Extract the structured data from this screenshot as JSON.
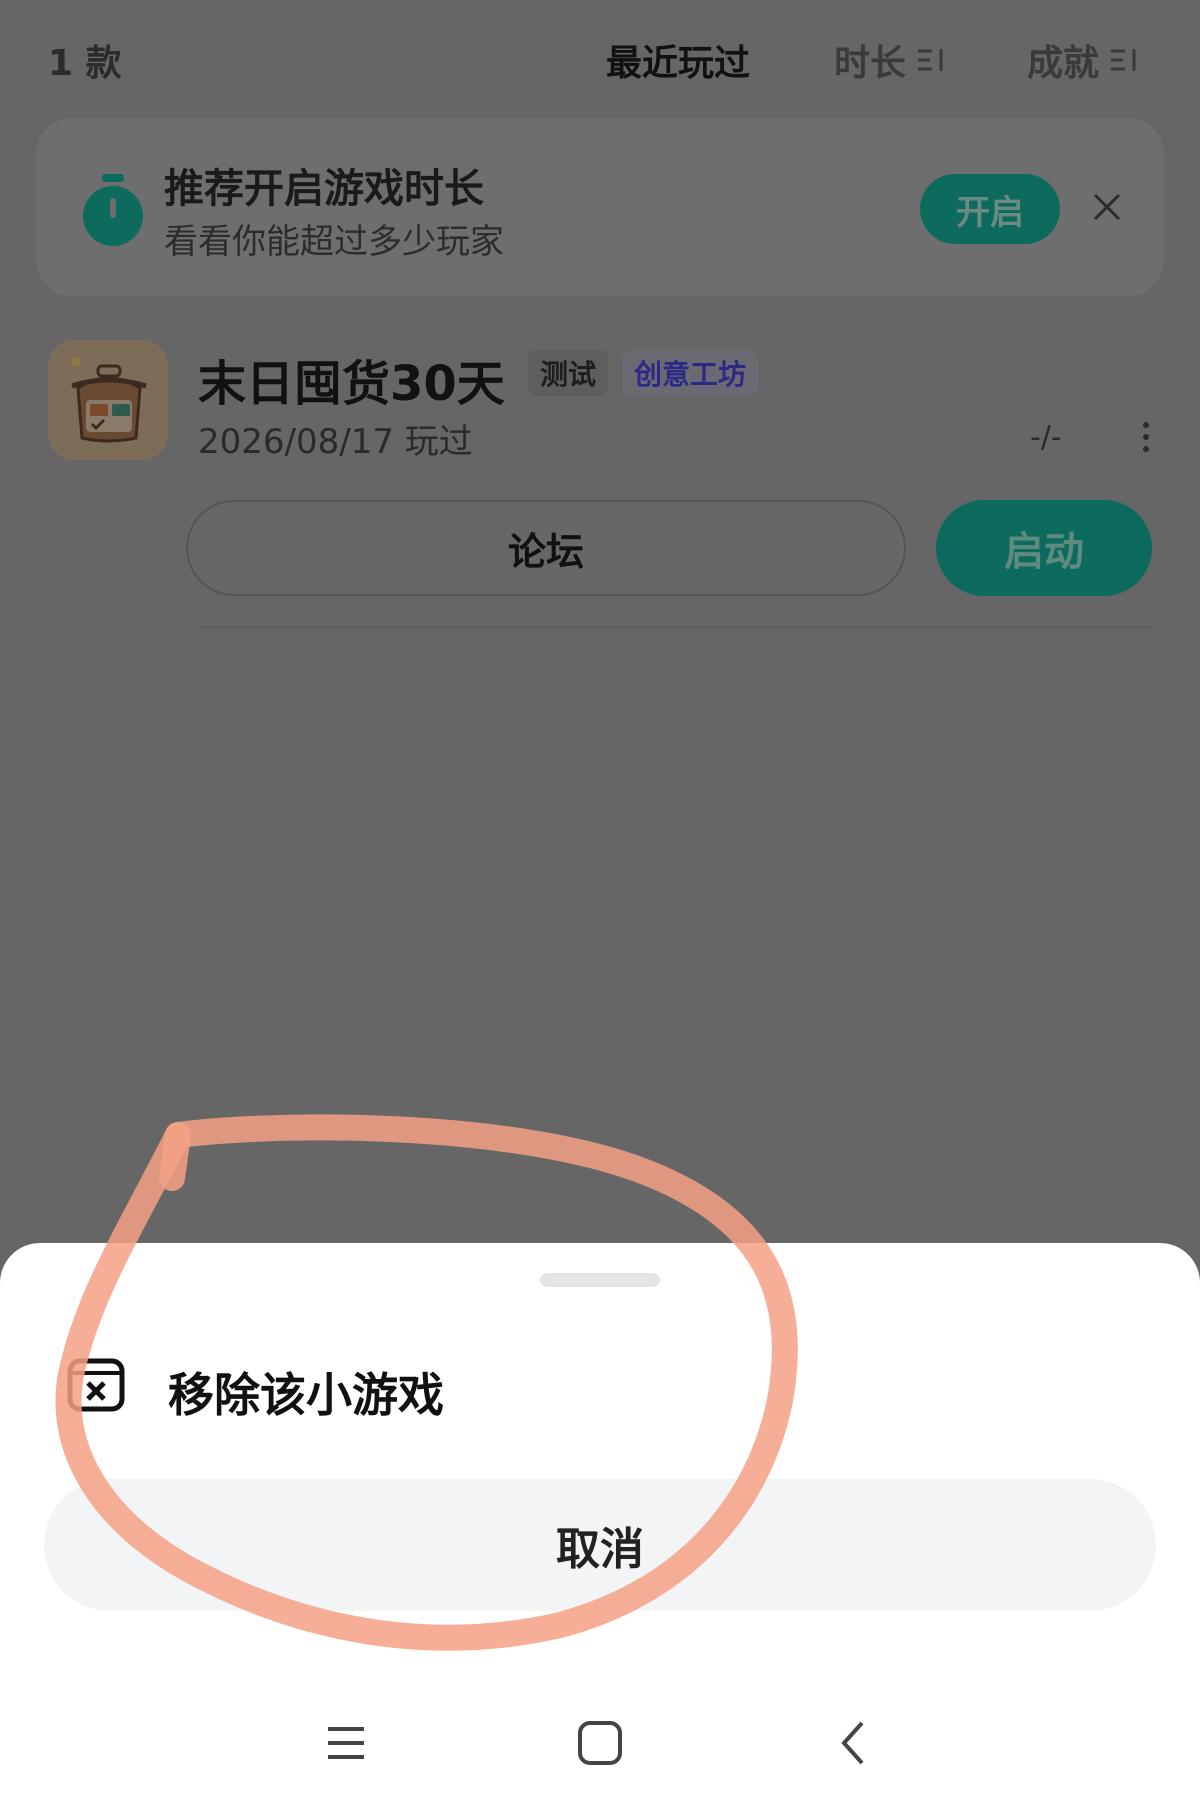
{
  "header": {
    "count_label": "1 款",
    "sort_options": [
      {
        "label": "最近玩过",
        "active": true
      },
      {
        "label": "时长",
        "active": false
      },
      {
        "label": "成就",
        "active": false
      }
    ]
  },
  "tip_card": {
    "title": "推荐开启游戏时长",
    "subtitle": "看看你能超过多少玩家",
    "enable_label": "开启",
    "icon": "stopwatch-icon"
  },
  "game": {
    "title": "末日囤货30天",
    "tags": [
      "测试",
      "创意工坊"
    ],
    "played_date": "2026/08/17 玩过",
    "stat": "-/-",
    "forum_label": "论坛",
    "launch_label": "启动"
  },
  "sheet": {
    "remove_label": "移除该小游戏",
    "cancel_label": "取消"
  },
  "colors": {
    "accent": "#0c6b5d",
    "overlay": "#666666",
    "annotation": "#f4a184"
  }
}
